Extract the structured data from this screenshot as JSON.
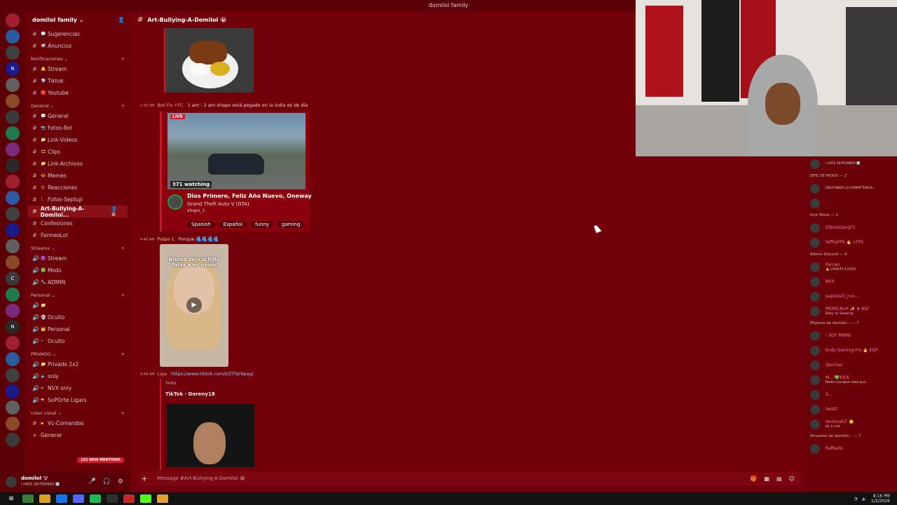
{
  "window": {
    "title": "domilol family"
  },
  "servers": [
    {
      "label": "",
      "badge": ""
    },
    {
      "label": "",
      "badge": "1"
    },
    {
      "label": "",
      "badge": "2"
    },
    {
      "label": "N",
      "badge": ""
    },
    {
      "label": "",
      "badge": ""
    },
    {
      "label": "",
      "badge": "10"
    },
    {
      "label": "",
      "badge": ""
    },
    {
      "label": "",
      "badge": "6"
    },
    {
      "label": "",
      "badge": ""
    },
    {
      "label": "",
      "badge": "9"
    },
    {
      "label": "",
      "badge": ""
    },
    {
      "label": "",
      "badge": ""
    },
    {
      "label": "",
      "badge": "5"
    },
    {
      "label": "",
      "badge": ""
    },
    {
      "label": "",
      "badge": ""
    },
    {
      "label": "",
      "badge": "18"
    },
    {
      "label": "C",
      "badge": ""
    },
    {
      "label": "",
      "badge": ""
    },
    {
      "label": "",
      "badge": "232"
    },
    {
      "label": "N",
      "badge": ""
    },
    {
      "label": "",
      "badge": "54"
    },
    {
      "label": "",
      "badge": "70"
    },
    {
      "label": "",
      "badge": ""
    },
    {
      "label": "",
      "badge": "179"
    },
    {
      "label": "",
      "badge": ""
    },
    {
      "label": "",
      "badge": "440"
    },
    {
      "label": "",
      "badge": "NEW"
    }
  ],
  "guild": {
    "name": "domilol family ⌄"
  },
  "categories": {
    "notificaciones": "Notificaciones ⌄",
    "general": "General ⌄",
    "streams": "Streams ⌄",
    "personal": "Personal ⌄",
    "privado": "PRIVADO ⌄",
    "crear": "crear canal ⌄"
  },
  "channels": {
    "sugerencias": "Sugerencias",
    "anuncios": "Anuncios",
    "stream": "Stream",
    "tiktok": "Tiktok",
    "youtube": "Youtube",
    "general": "General",
    "fotos_rol": "Fotos-Rol",
    "link_videos": "Link-Videos",
    "clips": "Clips",
    "link_archivos": "Link-Archivos",
    "memes": "Memes",
    "reacciones": "Reacciones",
    "fotos_septup": "Fotos-Septup",
    "art": "Art-Bullying-A-Domilol...",
    "confesiones": "Confesiones",
    "farmeolol": "FarmeoLol",
    "s_stream": "Stream",
    "mods": "Mods",
    "admin": "ADMIN",
    "p_oculto1": "Oculto",
    "p_personal": "Personal",
    "p_oculto2": "Oculto",
    "privado2x2": "Privado 2x2",
    "only": "only",
    "nvx_only": "NVX only",
    "soporte": "SoPOrte Ligars",
    "vc_comandos": "Vc-Comandos",
    "generar": "Generar"
  },
  "mentions_pill": "152 NEW MENTIONS",
  "user": {
    "name": "domilol ツ",
    "status": "I HATE SEPTEMBER 🔟"
  },
  "channel_header": {
    "hash": "#",
    "name": "Art-Bullying-A-Domilol 😭"
  },
  "messages": {
    "m1": {
      "time": "2:33 AM",
      "author": "Bot Fix ⚡FC",
      "text": "1 am - 2 am xhapo está pegado en la india es de día"
    },
    "m2": {
      "time": "4:46 AM",
      "author": "Pulpo 1",
      "text": "Porque 🫂🫂🫂🫂"
    },
    "m3": {
      "time": "4:46 AM",
      "author": "Laja",
      "text": "https://www.tiktok.com/t/ZThJr8pag/"
    }
  },
  "twitch_embed": {
    "live": "LIVE",
    "watching": "371 watching",
    "title": "Dios Primero, Feliz Año Nuevo, Oneway",
    "game": "Grand Theft Auto V (GTA)",
    "user": "xhapo_1",
    "tags": [
      "Spanish",
      "Español",
      "funny",
      "gaming"
    ]
  },
  "tiktok_video": {
    "caption": "Broma del cuchillo falso a mi novio"
  },
  "tiktok_embed": {
    "provider": "TikTok",
    "title": "TikTok · Dereny18"
  },
  "composer": {
    "placeholder": "Message #Art-Bullying-A-Domilol 😭"
  },
  "members": [
    {
      "type": "row",
      "name": "",
      "status": "I HATE SEPTEMBER 🔟"
    },
    {
      "type": "group",
      "name": "JEFE DE MODS — 2"
    },
    {
      "type": "row",
      "name": "",
      "status": "EDUCANDO LA COMPETENCIA..."
    },
    {
      "type": "row",
      "name": "",
      "status": ""
    },
    {
      "type": "group",
      "name": "Kick Mods — 2"
    },
    {
      "type": "row",
      "name": "ElbossGangF1",
      "status": ""
    },
    {
      "type": "row",
      "name": "YeffryFPS 🔥 ⚡FPS",
      "status": ""
    },
    {
      "type": "group",
      "name": "Admin-Discord — 4"
    },
    {
      "type": "row",
      "name": "Fernan",
      "status": "🔥 LOYALTY 4 EVER"
    },
    {
      "type": "row",
      "name": "NVX",
      "status": ""
    },
    {
      "type": "row",
      "name": "papolo20_nvx...",
      "status": ""
    },
    {
      "type": "row",
      "name": "MEMO.NvX ✨ ★ ASF",
      "status": "Baby no Sleeping"
    },
    {
      "type": "group",
      "name": "Mujeres de domilol... — 7"
    },
    {
      "type": "row",
      "name": "! SOY PININI",
      "status": ""
    },
    {
      "type": "row",
      "name": "Endy Gaming Fro 🔥 EGP",
      "status": ""
    },
    {
      "type": "row",
      "name": "@echax",
      "status": ""
    },
    {
      "type": "row",
      "name": "M... 💚KICK",
      "status": "Nadie consigue nada que..."
    },
    {
      "type": "row",
      "name": "S...",
      "status": ""
    },
    {
      "type": "row",
      "name": "twistt",
      "status": ""
    },
    {
      "type": "row",
      "name": "VenturaCF 🌟",
      "status": "lol, k mal"
    },
    {
      "type": "group",
      "name": "Amantes de domilol... — 7"
    },
    {
      "type": "row",
      "name": "Raffaelo",
      "status": ""
    }
  ],
  "taskbar": {
    "time": "8:16 PM",
    "date": "1/2/2026"
  }
}
